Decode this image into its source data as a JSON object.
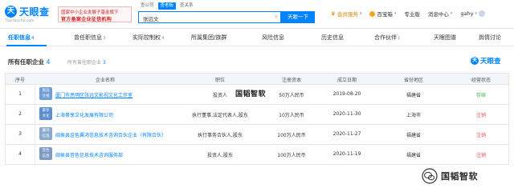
{
  "header": {
    "logo_glyph": "天",
    "logo_text": "天眼查",
    "logo_domain": "TianYancha.com",
    "slogan_line1": "国家中小企业发展子基金旗下",
    "slogan_line2": "官方备案企业征信机构",
    "search_tabs": [
      "查公司",
      "查老板",
      "查关系"
    ],
    "search_value": "张远文",
    "search_button": "天眼一下",
    "nav": {
      "vip": "会员服务",
      "coins": "百宝箱",
      "pro": "专业版",
      "messages": "消息中心",
      "user": "gahy"
    }
  },
  "tabs": [
    {
      "label": "任职信息",
      "count": "4"
    },
    {
      "label": "曾任职信息",
      "count": "3"
    },
    {
      "label": "实际控制权",
      "count": "4"
    },
    {
      "label": "所属集团/族群",
      "count": ""
    },
    {
      "label": "风险信息",
      "count": ""
    },
    {
      "label": "历史信息",
      "count": ""
    },
    {
      "label": "合作伙伴",
      "count": "1"
    },
    {
      "label": "天眼图谱",
      "count": ""
    },
    {
      "label": "舆情讨论",
      "count": ""
    }
  ],
  "section": {
    "title": "所有任职企业",
    "count": "4",
    "history_label": "所有曾任职企业",
    "history_count": "3",
    "brand_glyph": "天",
    "brand_text": "天眼查"
  },
  "table": {
    "columns": [
      "序号",
      "企业名称",
      "职位",
      "注册资本",
      "成立日期",
      "省份地区",
      "经营状态"
    ],
    "rows": [
      {
        "idx": "1",
        "badge": "张远\n文视",
        "name": "厦门市思明区张远文影视文化工作室",
        "position": "投资人",
        "capital": "50万人民币",
        "date": "2019-08-20",
        "province": "福建省",
        "status": "存续",
        "status_type": "active"
      },
      {
        "idx": "2",
        "badge": "豪享\n文化",
        "name": "上海豪享文化发展有限公司",
        "position": "执行董事,法定代表人,股东",
        "capital": "10万人民币",
        "date": "2020-11-30",
        "province": "上海市",
        "status": "注销",
        "status_type": "closed"
      },
      {
        "idx": "3",
        "badge": "翼鸿\n信息",
        "name": "闽侯县金色翼鸿信息技术咨询合伙企业（有限合伙）",
        "position": "执行事务合伙人,股东",
        "capital": "100万人民币",
        "date": "2020-11-27",
        "province": "福建省",
        "status": "注销",
        "status_type": "closed"
      },
      {
        "idx": "4",
        "badge": "音色\n信息",
        "name": "闽侯县音色信息技术咨询服务部",
        "position": "投资人,股东",
        "capital": "100万人民币",
        "date": "2020-11-19",
        "province": "福建省",
        "status": "注销",
        "status_type": "closed"
      }
    ]
  },
  "watermark": {
    "center": "国韬智软",
    "bottom": "国韬智软"
  },
  "colors": {
    "accent": "#0084ff",
    "active": "#3fb045",
    "closed": "#f04f4f"
  }
}
